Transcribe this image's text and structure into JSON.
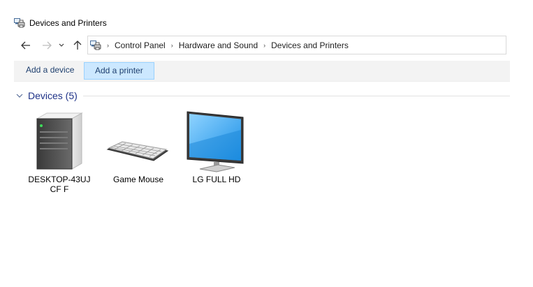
{
  "window": {
    "title": "Devices and Printers"
  },
  "address": {
    "breadcrumbs": [
      "Control Panel",
      "Hardware and Sound",
      "Devices and Printers"
    ]
  },
  "commands": {
    "add_device": "Add a device",
    "add_printer": "Add a printer"
  },
  "group": {
    "title": "Devices (5)"
  },
  "devices": [
    {
      "label": "DESKTOP-43UJCF F",
      "icon": "computer-tower-icon"
    },
    {
      "label": "Game Mouse",
      "icon": "keyboard-icon"
    },
    {
      "label": "LG FULL HD",
      "icon": "monitor-icon"
    }
  ],
  "colors": {
    "hover_bg": "#cce8ff",
    "hover_border": "#99d1ff",
    "group_title": "#1e3287",
    "command_text": "#1e3f6e"
  }
}
